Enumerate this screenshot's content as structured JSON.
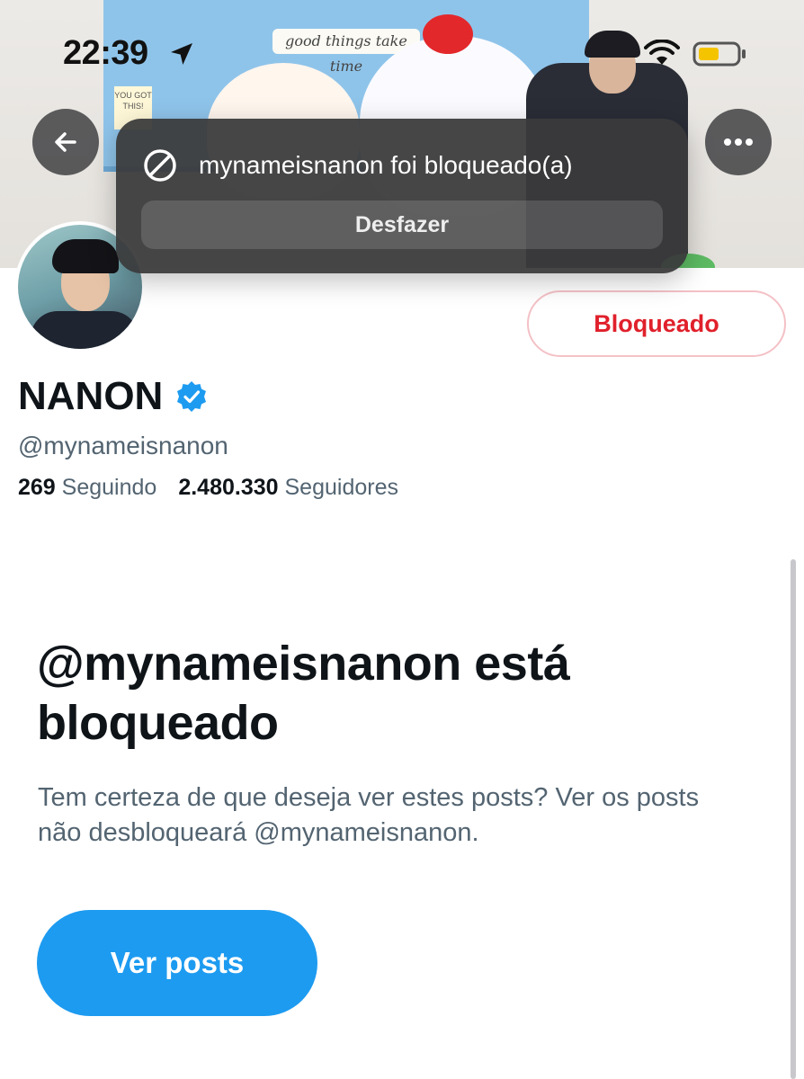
{
  "status_bar": {
    "time": "22:39",
    "location_icon": "location-arrow-icon",
    "wifi_icon": "wifi-icon",
    "battery_icon": "battery-icon",
    "battery_color": "#f5c400"
  },
  "banner": {
    "sign_text": "good things take time",
    "note_text": "YOU GOT THIS!"
  },
  "nav": {
    "back_icon": "arrow-left-icon",
    "more_icon": "ellipsis-icon"
  },
  "toast": {
    "icon": "blocked-circle-icon",
    "message": "mynameisnanon foi bloqueado(a)",
    "undo_label": "Desfazer"
  },
  "profile": {
    "display_name": "NANON",
    "verified_icon": "verified-badge-icon",
    "verified_color": "#1d9bf0",
    "handle": "@mynameisnanon",
    "following_count": "269",
    "following_label": "Seguindo",
    "followers_count": "2.480.330",
    "followers_label": "Seguidores",
    "blocked_button_label": "Bloqueado",
    "blocked_color": "#e0202b"
  },
  "blocked_notice": {
    "title": "@mynameisnanon está bloqueado",
    "description": "Tem certeza de que deseja ver estes posts? Ver os posts não desbloqueará @mynameisnanon.",
    "view_posts_label": "Ver posts",
    "accent_color": "#1d9bf0"
  }
}
